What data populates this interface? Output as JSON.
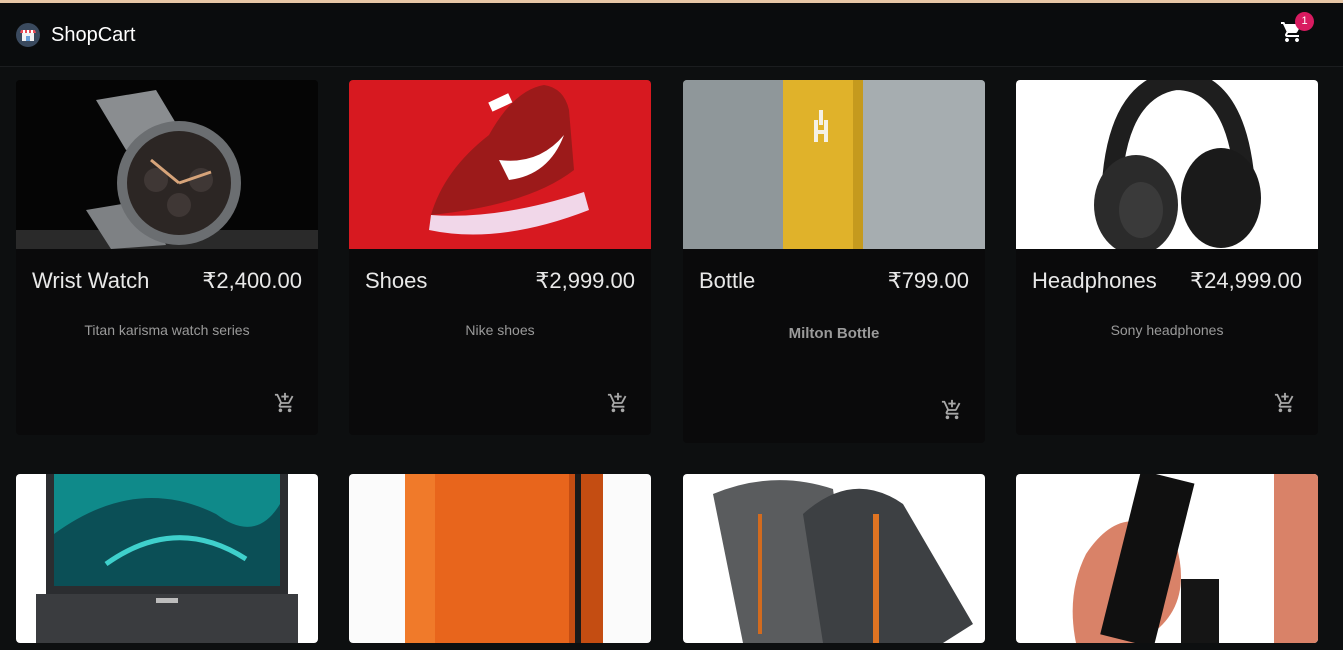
{
  "app": {
    "title": "ShopCart",
    "logo_icon": "shop-logo-icon"
  },
  "cart": {
    "icon": "shopping-cart-icon",
    "count": "1"
  },
  "products": [
    {
      "title": "Wrist Watch",
      "price": "₹2,400.00",
      "description": "Titan karisma watch series",
      "image": "wrist-watch-image"
    },
    {
      "title": "Shoes",
      "price": "₹2,999.00",
      "description": "Nike shoes",
      "image": "shoes-image"
    },
    {
      "title": "Bottle",
      "price": "₹799.00",
      "description": "Milton Bottle",
      "image": "bottle-image"
    },
    {
      "title": "Headphones",
      "price": "₹24,999.00",
      "description": "Sony headphones",
      "image": "headphones-image"
    },
    {
      "image": "laptop-image"
    },
    {
      "image": "orange-bottle-image"
    },
    {
      "image": "jacket-image"
    },
    {
      "image": "lipstick-image"
    }
  ],
  "add_to_cart_icon": "add-shopping-cart-icon",
  "colors": {
    "background": "#0d0f10",
    "badge": "#d81b60",
    "appbar": "#0a0c0d"
  }
}
